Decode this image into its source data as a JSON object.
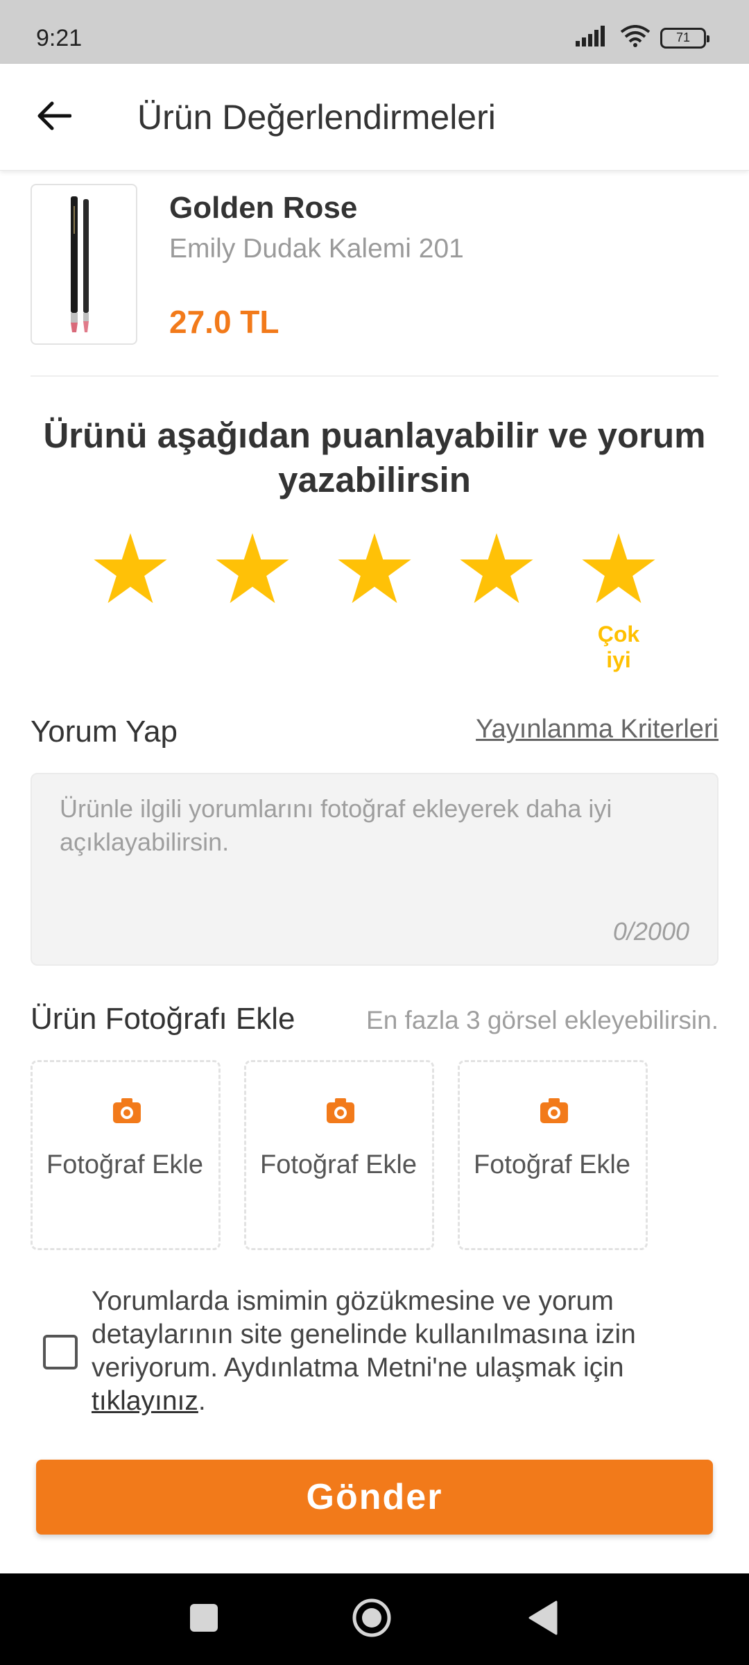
{
  "status_bar": {
    "time": "9:21",
    "battery": "71",
    "icons": [
      "signal-icon",
      "wifi-icon",
      "battery-icon"
    ]
  },
  "header": {
    "title": "Ürün Değerlendirmeleri",
    "back_icon": "arrow-left-icon"
  },
  "product": {
    "brand": "Golden Rose",
    "name": "Emily Dudak Kalemi 201",
    "price": "27.0 TL"
  },
  "rating": {
    "heading": "Ürünü aşağıdan puanlayabilir ve yorum yazabilirsin",
    "value": 5,
    "max": 5,
    "label": "Çok iyi",
    "star_color": "#ffc107"
  },
  "comment": {
    "title": "Yorum Yap",
    "criteria_link": "Yayınlanma Kriterleri",
    "placeholder": "Ürünle ilgili yorumlarını fotoğraf ekleyerek daha iyi açıklayabilirsin.",
    "value": "",
    "counter": "0/2000"
  },
  "photos": {
    "title": "Ürün Fotoğrafı Ekle",
    "hint": "En fazla 3 görsel ekleyebilirsin.",
    "slots": [
      {
        "label": "Fotoğraf Ekle"
      },
      {
        "label": "Fotoğraf Ekle"
      },
      {
        "label": "Fotoğraf Ekle"
      }
    ]
  },
  "consent": {
    "text": "Yorumlarda ismimin gözükmesine ve yorum detaylarının site genelinde kullanılmasına izin veriyorum. Aydınlatma Metni'ne ulaşmak için ",
    "link": "tıklayınız",
    "suffix": ".",
    "checked": false
  },
  "submit": {
    "label": "Gönder"
  },
  "colors": {
    "accent": "#f27a1a",
    "star": "#ffc107",
    "rating_label": "#ffc000"
  },
  "nav_bar": {
    "icons": [
      "square-icon",
      "circle-icon",
      "triangle-back-icon"
    ]
  }
}
